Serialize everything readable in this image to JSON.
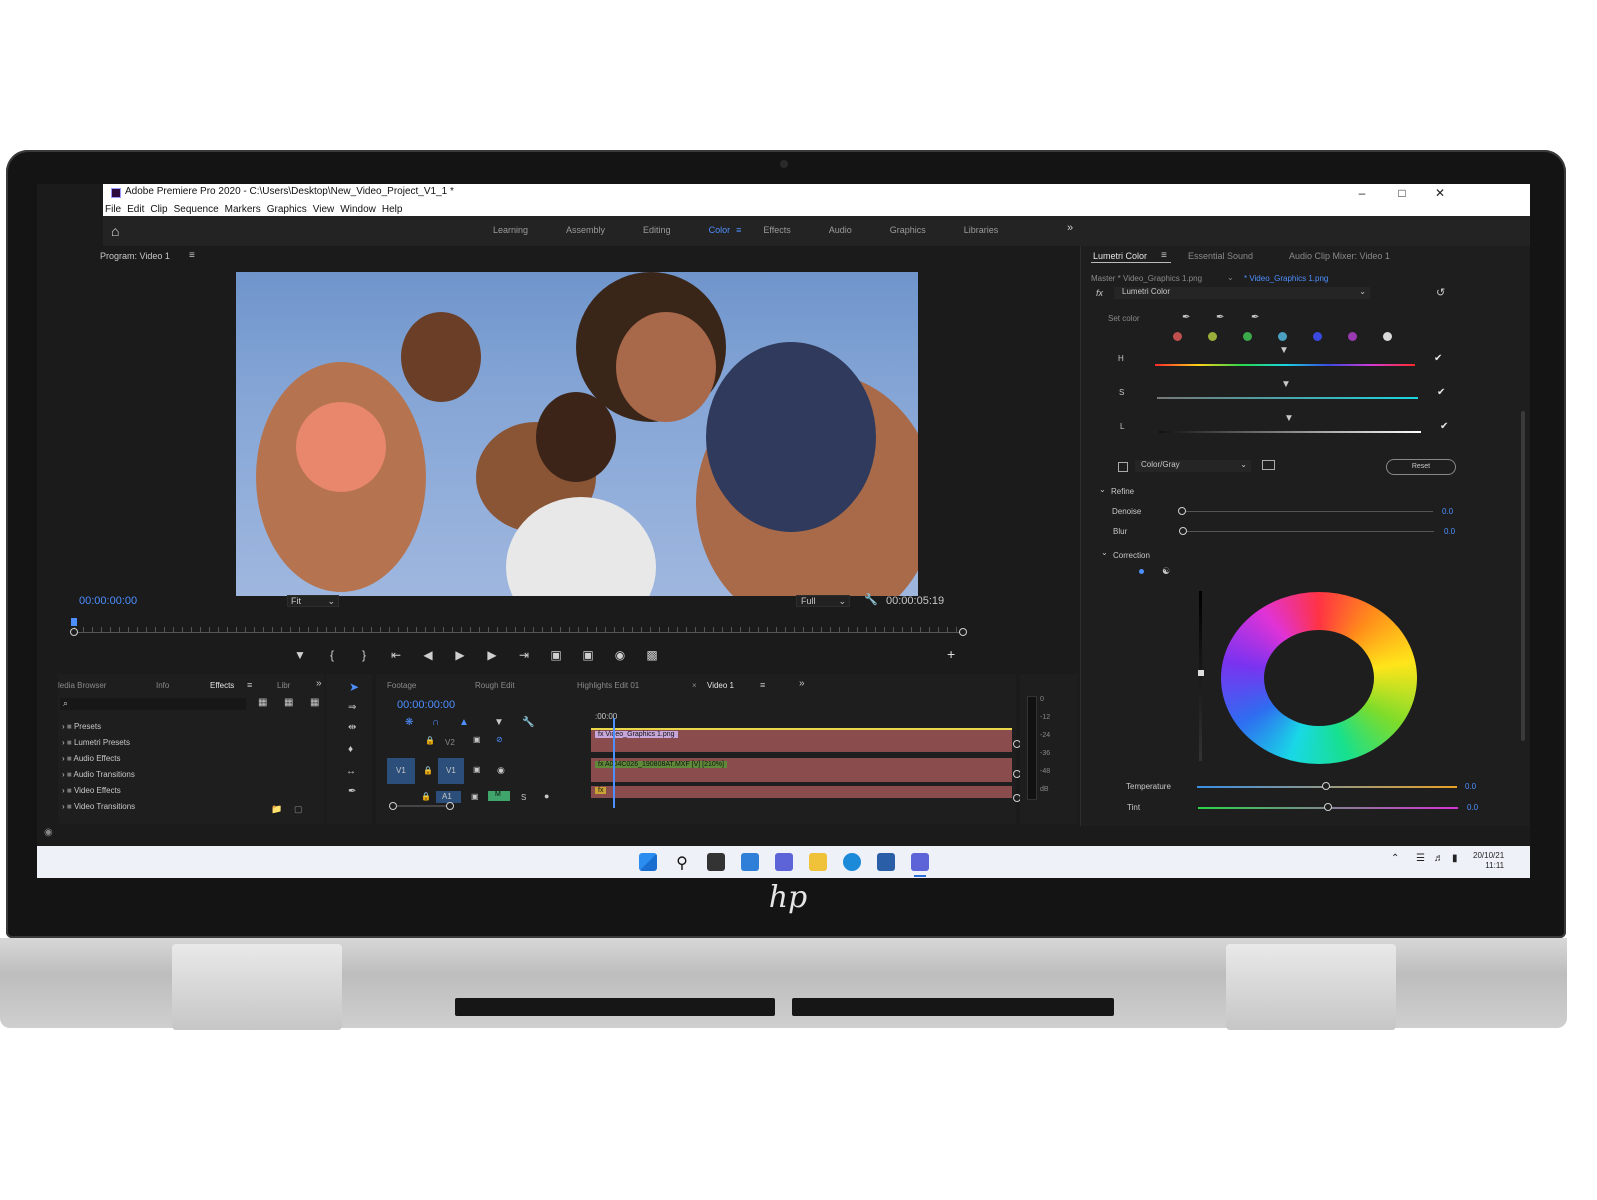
{
  "window": {
    "title": "Adobe Premiere Pro 2020 - C:\\Users\\Desktop\\New_Video_Project_V1_1 *",
    "menu": [
      "File",
      "Edit",
      "Clip",
      "Sequence",
      "Markers",
      "Graphics",
      "View",
      "Window",
      "Help"
    ]
  },
  "workspaces": {
    "tabs": [
      "Learning",
      "Assembly",
      "Editing",
      "Color",
      "Effects",
      "Audio",
      "Graphics",
      "Libraries"
    ],
    "active": "Color",
    "more": "»"
  },
  "program": {
    "title": "Program: Video 1",
    "menu_icon": "≡",
    "timecode_current": "00:00:00:00",
    "fit": "Fit",
    "quality": "Full",
    "timecode_duration": "00:00:05:19",
    "add": "+"
  },
  "lumetri": {
    "tabs": [
      "Lumetri Color",
      "Essential Sound",
      "Audio Clip Mixer: Video 1"
    ],
    "menu_icon": "≡",
    "master": "Master * Video_Graphics 1.png",
    "clip": "* Video_Graphics 1.png",
    "fx": "fx",
    "effect": "Lumetri Color",
    "set_color": "Set color",
    "swatches": [
      "#c0504d",
      "#9aad3a",
      "#3aaa4a",
      "#4aa0c0",
      "#3a4ae0",
      "#9a3ab0",
      "#d9d9d9"
    ],
    "h": "H",
    "s": "S",
    "l": "L",
    "color_gray": "Color/Gray",
    "reset": "Reset",
    "refine": "Refine",
    "denoise": {
      "label": "Denoise",
      "value": "0.0"
    },
    "blur": {
      "label": "Blur",
      "value": "0.0"
    },
    "correction": "Correction",
    "temperature": {
      "label": "Temperature",
      "value": "0.0"
    },
    "tint": {
      "label": "Tint",
      "value": "0.0"
    }
  },
  "effects_panel": {
    "tabs": [
      "ledia Browser",
      "Info",
      "Effects",
      "Libr"
    ],
    "active": "Effects",
    "menu_icon": "≡",
    "more": "»",
    "items": [
      "Presets",
      "Lumetri Presets",
      "Audio Effects",
      "Audio Transitions",
      "Video Effects",
      "Video Transitions"
    ]
  },
  "timeline": {
    "tabs": [
      "Footage",
      "Rough Edit",
      "Highlights Edit 01",
      "Video 1"
    ],
    "close": "×",
    "menu_icon": "≡",
    "more": "»",
    "timecode": "00:00:00:00",
    "ruler": ":00:00",
    "tracks": [
      "V2",
      "V1",
      "A1"
    ],
    "source": [
      "V1",
      "A1"
    ],
    "mute": "M",
    "solo": "S",
    "clips": [
      "Video_Graphics 1.png",
      "A004C026_190808AT.MXF [V] [210%]"
    ]
  },
  "meter": {
    "scale": [
      "0",
      "-12",
      "-24",
      "-36",
      "-48",
      "dB"
    ]
  },
  "taskbar": {
    "date": "20/10/21",
    "time": "11:11"
  },
  "brand": "hp"
}
